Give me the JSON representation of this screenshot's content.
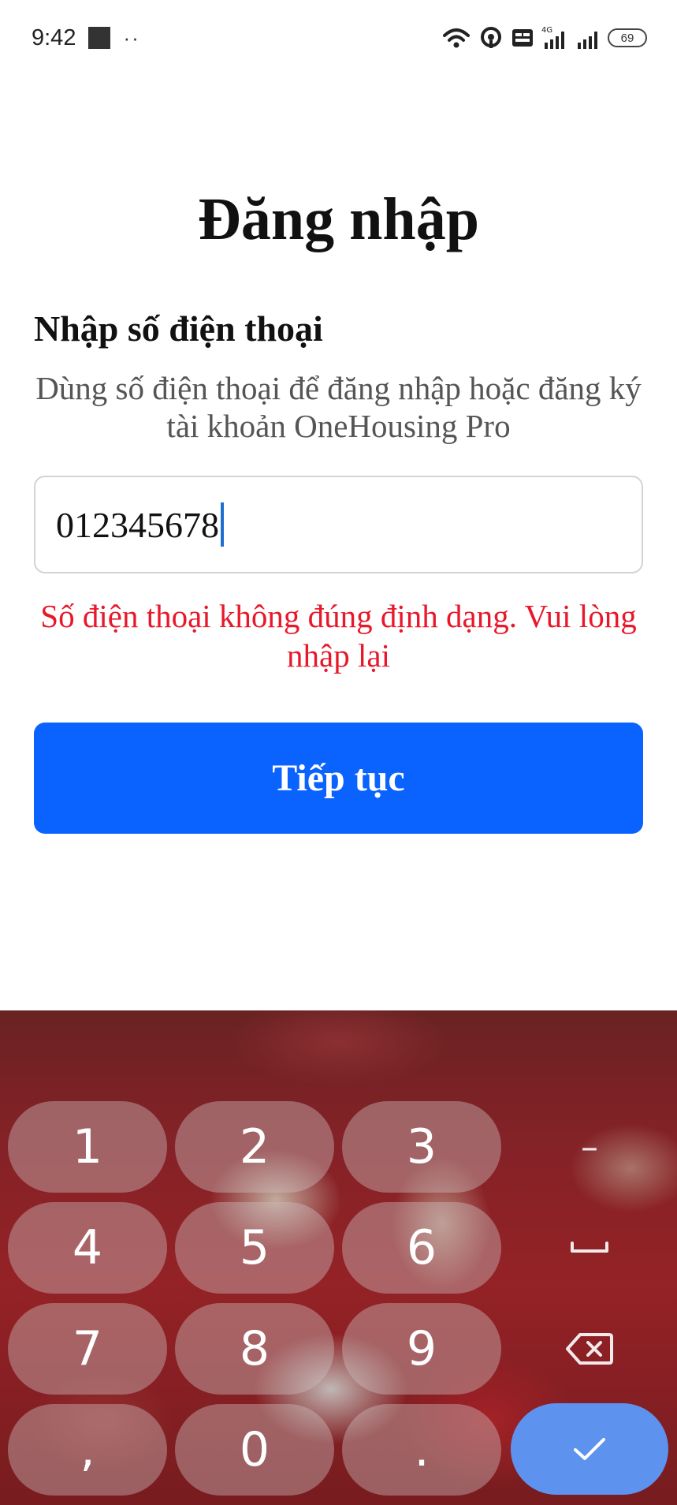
{
  "status_bar": {
    "time": "9:42",
    "dots": "··",
    "network": "4G",
    "battery": "69"
  },
  "login": {
    "title": "Đăng nhập",
    "heading": "Nhập số điện thoại",
    "description": "Dùng số điện thoại để đăng nhập hoặc đăng ký tài khoản OneHousing Pro",
    "phone_value": "012345678",
    "error": "Số điện thoại không đúng định dạng. Vui lòng nhập lại",
    "continue_label": "Tiếp tục"
  },
  "keyboard": {
    "keys": [
      "1",
      "2",
      "3",
      "4",
      "5",
      "6",
      "7",
      "8",
      "9",
      ",",
      "0",
      "."
    ],
    "side_keys": [
      "–",
      "space-icon",
      "backspace-icon",
      "check-icon"
    ]
  },
  "colors": {
    "primary": "#0a63ff",
    "error": "#e8182a",
    "confirm_key": "#5d93ef"
  }
}
